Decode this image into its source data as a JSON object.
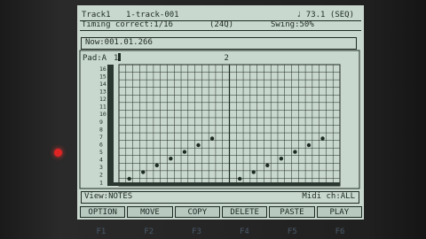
{
  "header": {
    "track_label": "Track1",
    "track_name": "1-track-001",
    "tempo": "♩ 73.1 (SEQ)",
    "timing_label": "Timing correct:1/16",
    "timing_value": "(24Q)",
    "swing": "Swing:50%"
  },
  "now": "Now:001.01.266",
  "grid": {
    "pad_label": "Pad:A",
    "bar_markers": [
      "1",
      "2"
    ],
    "pads": [
      "16",
      "15",
      "14",
      "13",
      "12",
      "11",
      "10",
      "9",
      "8",
      "7",
      "6",
      "5",
      "4",
      "3",
      "2",
      "1"
    ]
  },
  "notes": [
    {
      "step": 1,
      "level": 1
    },
    {
      "step": 3,
      "level": 2
    },
    {
      "step": 5,
      "level": 3
    },
    {
      "step": 7,
      "level": 4
    },
    {
      "step": 9,
      "level": 5
    },
    {
      "step": 11,
      "level": 6
    },
    {
      "step": 13,
      "level": 7
    },
    {
      "step": 17,
      "level": 1
    },
    {
      "step": 19,
      "level": 2
    },
    {
      "step": 21,
      "level": 3
    },
    {
      "step": 23,
      "level": 4
    },
    {
      "step": 25,
      "level": 5
    },
    {
      "step": 27,
      "level": 6
    },
    {
      "step": 29,
      "level": 7
    }
  ],
  "footer": {
    "view": "View:NOTES",
    "midi": "Midi ch:ALL"
  },
  "tabs": [
    "OPTION",
    "MOVE",
    "COPY",
    "DELETE",
    "PASTE",
    "PLAY"
  ],
  "softkeys": [
    "F1",
    "F2",
    "F3",
    "F4",
    "F5",
    "F6"
  ]
}
